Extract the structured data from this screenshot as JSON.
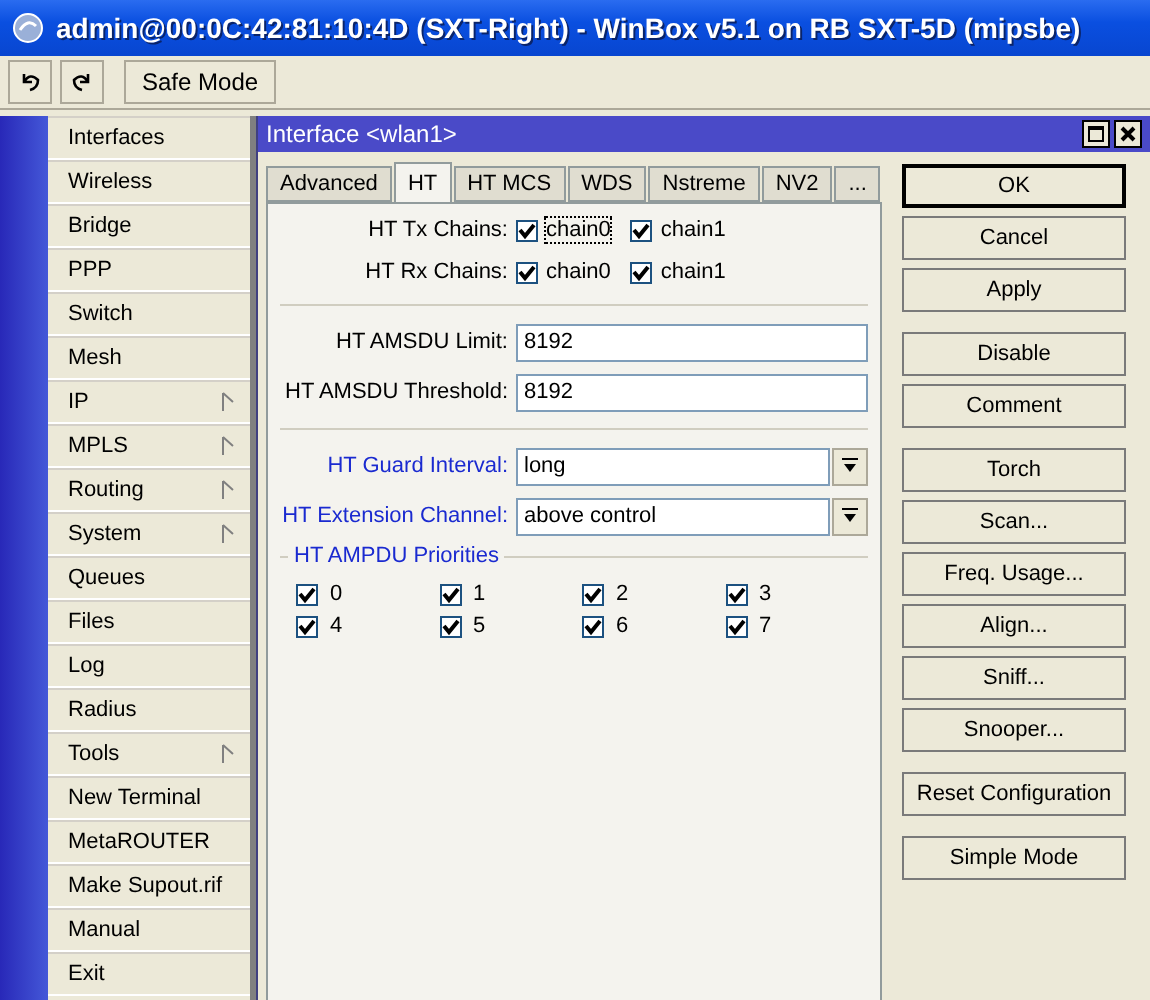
{
  "title": "admin@00:0C:42:81:10:4D (SXT-Right) - WinBox v5.1 on RB SXT-5D (mipsbe)",
  "toolbar": {
    "safe_mode": "Safe Mode"
  },
  "menu": [
    {
      "label": "Interfaces",
      "submenu": false
    },
    {
      "label": "Wireless",
      "submenu": false
    },
    {
      "label": "Bridge",
      "submenu": false
    },
    {
      "label": "PPP",
      "submenu": false
    },
    {
      "label": "Switch",
      "submenu": false
    },
    {
      "label": "Mesh",
      "submenu": false
    },
    {
      "label": "IP",
      "submenu": true
    },
    {
      "label": "MPLS",
      "submenu": true
    },
    {
      "label": "Routing",
      "submenu": true
    },
    {
      "label": "System",
      "submenu": true
    },
    {
      "label": "Queues",
      "submenu": false
    },
    {
      "label": "Files",
      "submenu": false
    },
    {
      "label": "Log",
      "submenu": false
    },
    {
      "label": "Radius",
      "submenu": false
    },
    {
      "label": "Tools",
      "submenu": true
    },
    {
      "label": "New Terminal",
      "submenu": false
    },
    {
      "label": "MetaROUTER",
      "submenu": false
    },
    {
      "label": "Make Supout.rif",
      "submenu": false
    },
    {
      "label": "Manual",
      "submenu": false
    },
    {
      "label": "Exit",
      "submenu": false
    }
  ],
  "window": {
    "title": "Interface <wlan1>",
    "tabs": [
      {
        "label": "Advanced",
        "selected": false
      },
      {
        "label": "HT",
        "selected": true
      },
      {
        "label": "HT MCS",
        "selected": false
      },
      {
        "label": "WDS",
        "selected": false
      },
      {
        "label": "Nstreme",
        "selected": false
      },
      {
        "label": "NV2",
        "selected": false
      },
      {
        "label": "...",
        "selected": false
      }
    ],
    "chains": [
      {
        "label": "HT Tx Chains:",
        "options": [
          {
            "label": "chain0",
            "checked": true,
            "focused": true
          },
          {
            "label": "chain1",
            "checked": true,
            "focused": false
          }
        ]
      },
      {
        "label": "HT Rx Chains:",
        "options": [
          {
            "label": "chain0",
            "checked": true,
            "focused": false
          },
          {
            "label": "chain1",
            "checked": true,
            "focused": false
          }
        ]
      }
    ],
    "fields": [
      {
        "label": "HT AMSDU Limit:",
        "value": "8192"
      },
      {
        "label": "HT AMSDU Threshold:",
        "value": "8192"
      }
    ],
    "dropdowns": [
      {
        "label": "HT Guard Interval:",
        "value": "long"
      },
      {
        "label": "HT Extension Channel:",
        "value": "above control"
      }
    ],
    "ampdu": {
      "title": "HT AMPDU Priorities",
      "items": [
        {
          "label": "0",
          "checked": true
        },
        {
          "label": "1",
          "checked": true
        },
        {
          "label": "2",
          "checked": true
        },
        {
          "label": "3",
          "checked": true
        },
        {
          "label": "4",
          "checked": true
        },
        {
          "label": "5",
          "checked": true
        },
        {
          "label": "6",
          "checked": true
        },
        {
          "label": "7",
          "checked": true
        }
      ]
    },
    "button_groups": [
      [
        {
          "label": "OK",
          "default": true
        },
        {
          "label": "Cancel",
          "default": false
        },
        {
          "label": "Apply",
          "default": false
        }
      ],
      [
        {
          "label": "Disable",
          "default": false
        },
        {
          "label": "Comment",
          "default": false
        }
      ],
      [
        {
          "label": "Torch",
          "default": false
        },
        {
          "label": "Scan...",
          "default": false
        },
        {
          "label": "Freq. Usage...",
          "default": false
        },
        {
          "label": "Align...",
          "default": false
        },
        {
          "label": "Sniff...",
          "default": false
        },
        {
          "label": "Snooper...",
          "default": false
        }
      ],
      [
        {
          "label": "Reset Configuration",
          "default": false
        }
      ],
      [
        {
          "label": "Simple Mode",
          "default": false
        }
      ]
    ]
  }
}
